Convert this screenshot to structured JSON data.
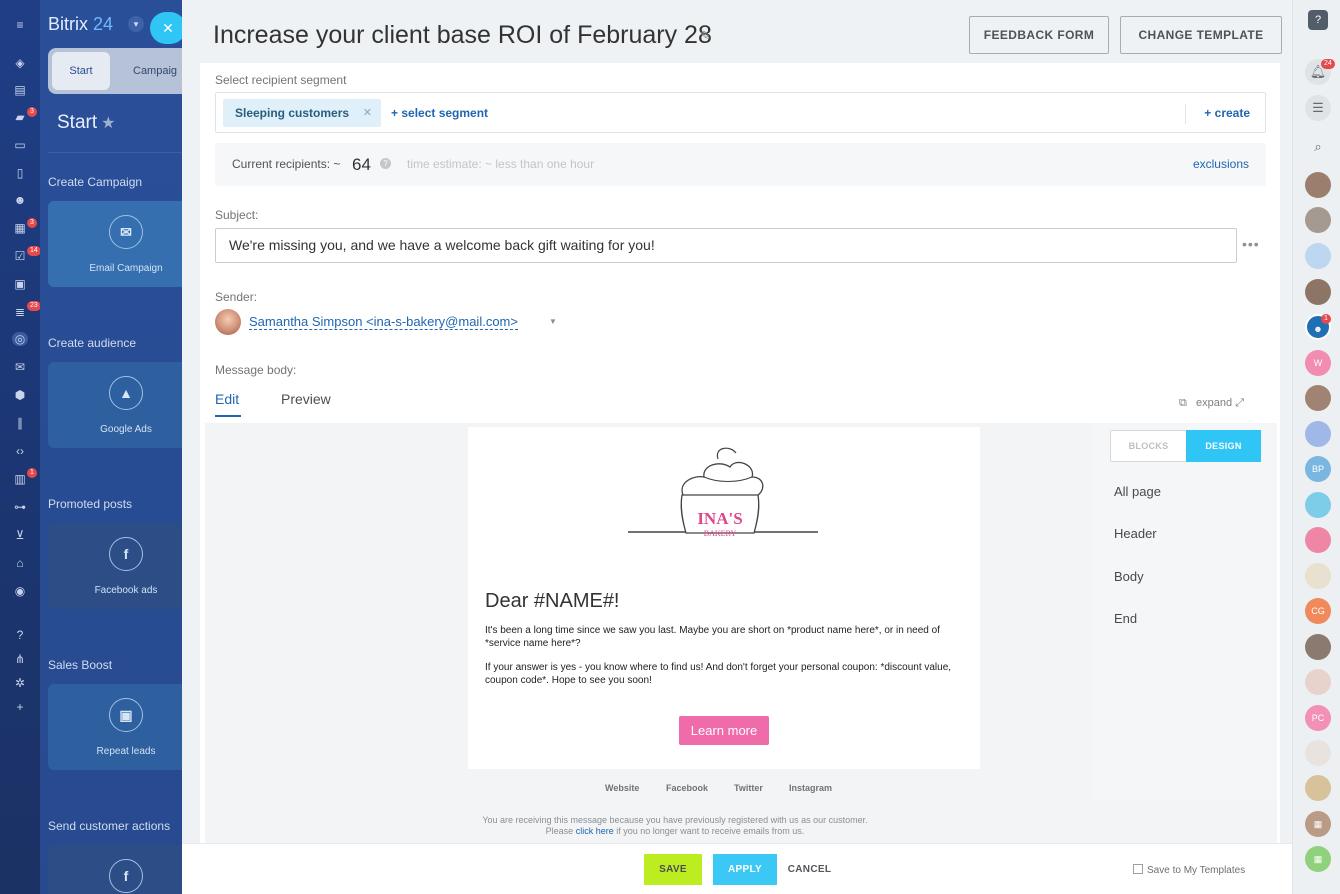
{
  "app": {
    "brand": "Bitrix",
    "brand_version": "24"
  },
  "left_rail": {
    "icons": [
      "menu-icon",
      "activity-icon",
      "feed-icon",
      "chat-icon",
      "inbox-icon",
      "document-icon",
      "group-icon",
      "calendar-icon",
      "tasks-icon",
      "contacts-icon",
      "filter-icon",
      "target-icon",
      "mail-icon",
      "box-icon",
      "analytics-icon",
      "code-icon",
      "robot-icon",
      "sliders-icon",
      "cart-icon",
      "bank-icon",
      "check-icon",
      "help-icon",
      "sitemap-icon",
      "gear-icon",
      "plus-icon"
    ],
    "badges": {
      "chat": "3",
      "calendar": "3",
      "tasks": "14",
      "filter": "23",
      "robot": "1"
    }
  },
  "left_panel": {
    "tabs": [
      "Start",
      "Campaig"
    ],
    "heading": "Start",
    "sections": [
      {
        "title": "Create Campaign",
        "card": "Email Campaign"
      },
      {
        "title": "Create audience",
        "card": "Google Ads"
      },
      {
        "title": "Promoted posts",
        "card": "Facebook ads"
      },
      {
        "title": "Sales Boost",
        "card": "Repeat leads"
      },
      {
        "title": "Send customer actions",
        "card": ""
      }
    ]
  },
  "header": {
    "title": "Increase your client base ROI of February 28",
    "feedback_button": "FEEDBACK FORM",
    "template_button": "CHANGE TEMPLATE"
  },
  "form": {
    "segment_label": "Select recipient segment",
    "segment_chip": "Sleeping customers",
    "select_segment": "+ select segment",
    "create": "+ create",
    "recipients_label": "Current recipients: ~",
    "recipients_count": "64",
    "time_estimate": "time estimate: ~ less than one hour",
    "exclusions": "exclusions",
    "subject_label": "Subject:",
    "subject_value": "We're missing you, and we have a welcome back gift waiting for you!",
    "sender_label": "Sender:",
    "sender_value": "Samantha Simpson <ina-s-bakery@mail.com>",
    "body_label": "Message body:",
    "tab_edit": "Edit",
    "tab_preview": "Preview",
    "expand": "expand"
  },
  "email": {
    "logo_text_1": "INA'S",
    "logo_text_2": "BAKERY",
    "greeting": "Dear #NAME#!",
    "paragraph_1": "It's been a long time since we saw you last. Maybe you are short on *product name here*, or in need of *service name here*?",
    "paragraph_2": "If your answer is yes - you know where to find us! And don't forget your personal coupon: *discount value, coupon code*. Hope to see you soon!",
    "cta": "Learn more",
    "social": [
      "Website",
      "Facebook",
      "Twitter",
      "Instagram"
    ],
    "footer_line_1": "You are receiving this message because you have previously registered with us as our customer.",
    "footer_please": "Please ",
    "footer_link": "click here",
    "footer_rest": " if you no longer want to receive emails from us."
  },
  "design_panel": {
    "blocks": "BLOCKS",
    "design": "DESIGN",
    "items": [
      "All page",
      "Header",
      "Body",
      "End"
    ]
  },
  "actions": {
    "save": "SAVE",
    "apply": "APPLY",
    "cancel": "CANCEL",
    "save_template": "Save to My Templates"
  },
  "right_rail": {
    "notifications_badge": "24",
    "group_badge": "1",
    "initials": [
      "W",
      "BP",
      "CG",
      "PC"
    ]
  },
  "colors": {
    "accent": "#2fc6f6",
    "link": "#2066b0",
    "save": "#bbed21",
    "cta": "#f06baa"
  }
}
